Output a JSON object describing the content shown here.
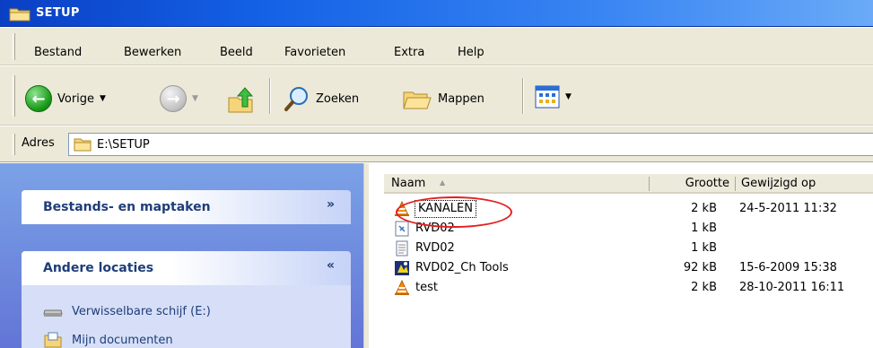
{
  "window": {
    "title": "SETUP"
  },
  "menu": [
    "Bestand",
    "Bewerken",
    "Beeld",
    "Favorieten",
    "Extra",
    "Help"
  ],
  "toolbar": {
    "back": "Vorige",
    "search": "Zoeken",
    "folders": "Mappen"
  },
  "address": {
    "label": "Adres",
    "value": "E:\\SETUP"
  },
  "left_pane": {
    "panels": [
      {
        "title": "Bestands- en maptaken",
        "chevron": "»"
      },
      {
        "title": "Andere locaties",
        "chevron": "«"
      }
    ],
    "locations": [
      "Verwisselbare schijf (E:)",
      "Mijn documenten"
    ]
  },
  "columns": {
    "name": "Naam",
    "size": "Grootte",
    "modified": "Gewijzigd op"
  },
  "files": [
    {
      "name": "KANALEN",
      "size": "2 kB",
      "modified": "24-5-2011 11:32",
      "icon": "vlc-icon"
    },
    {
      "name": "RVD02",
      "size": "1 kB",
      "modified": "",
      "icon": "ini-file-icon"
    },
    {
      "name": "RVD02",
      "size": "1 kB",
      "modified": "",
      "icon": "text-file-icon"
    },
    {
      "name": "RVD02_Ch Tools",
      "size": "92 kB",
      "modified": "15-6-2009 15:38",
      "icon": "app-icon"
    },
    {
      "name": "test",
      "size": "2 kB",
      "modified": "28-10-2011 16:11",
      "icon": "vlc-icon"
    }
  ],
  "colors": {
    "title_gradient_start": "#0a3fc4",
    "left_pane": "#7ba2e7",
    "highlight": "#e41f1f"
  }
}
